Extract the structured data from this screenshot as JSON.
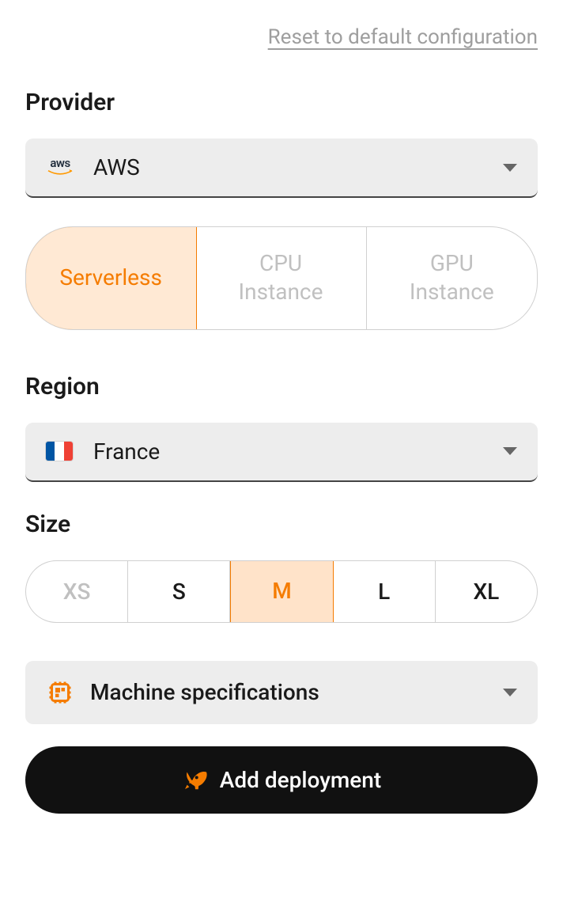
{
  "reset_link": "Reset to default configuration",
  "provider": {
    "title": "Provider",
    "selected": "AWS",
    "icon": "aws-logo"
  },
  "tabs": [
    {
      "label": "Serverless",
      "active": true
    },
    {
      "label_line1": "CPU",
      "label_line2": "Instance",
      "active": false
    },
    {
      "label_line1": "GPU",
      "label_line2": "Instance",
      "active": false
    }
  ],
  "region": {
    "title": "Region",
    "selected": "France",
    "icon": "flag-france"
  },
  "size": {
    "title": "Size",
    "options": [
      {
        "label": "XS",
        "state": "disabled"
      },
      {
        "label": "S",
        "state": "normal"
      },
      {
        "label": "M",
        "state": "active"
      },
      {
        "label": "L",
        "state": "normal"
      },
      {
        "label": "XL",
        "state": "normal"
      }
    ]
  },
  "machine_spec_label": "Machine specifications",
  "add_deployment_label": "Add deployment",
  "colors": {
    "accent": "#f57c00",
    "accent_bg": "#ffe3c9",
    "disabled_text": "#c0c0c0"
  }
}
